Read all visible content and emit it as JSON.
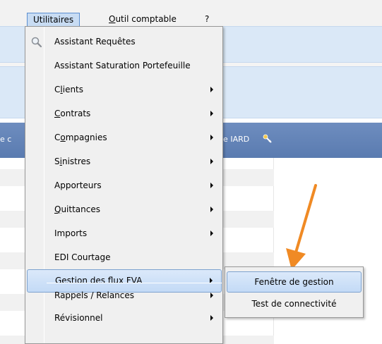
{
  "menubar": {
    "items": [
      {
        "label": "Utilitaires"
      },
      {
        "label_pre": "",
        "label_u": "O",
        "label_rest": "util comptable"
      },
      {
        "label": "?"
      }
    ]
  },
  "header": {
    "left_fragment": "e c",
    "right_fragment": "le IARD"
  },
  "menu": {
    "items": [
      {
        "pre": "Assistant Requêtes",
        "u": "",
        "post": ""
      },
      {
        "pre": "Assistant Saturation Portefeuille",
        "u": "",
        "post": ""
      },
      {
        "pre": "C",
        "u": "l",
        "post": "ients"
      },
      {
        "pre": "",
        "u": "C",
        "post": "ontrats"
      },
      {
        "pre": "C",
        "u": "o",
        "post": "mpagnies"
      },
      {
        "pre": "S",
        "u": "i",
        "post": "nistres"
      },
      {
        "pre": "Apporteurs",
        "u": "",
        "post": ""
      },
      {
        "pre": "",
        "u": "Q",
        "post": "uittances"
      },
      {
        "pre": "Imports",
        "u": "",
        "post": ""
      },
      {
        "pre": "EDI Courtage",
        "u": "",
        "post": ""
      },
      {
        "pre": "Gestion des flux FVA",
        "u": "",
        "post": ""
      },
      {
        "pre": "Rappels / Relances",
        "u": "",
        "post": ""
      },
      {
        "pre": "Révisionnel",
        "u": "",
        "post": ""
      }
    ]
  },
  "submenu": {
    "items": [
      {
        "label": "Fenêtre de gestion"
      },
      {
        "label": "Test de connectivité"
      }
    ]
  },
  "colors": {
    "highlight_border": "#7da2ce",
    "header_blue": "#5a7bb0",
    "annotation_arrow": "#f08a24"
  }
}
